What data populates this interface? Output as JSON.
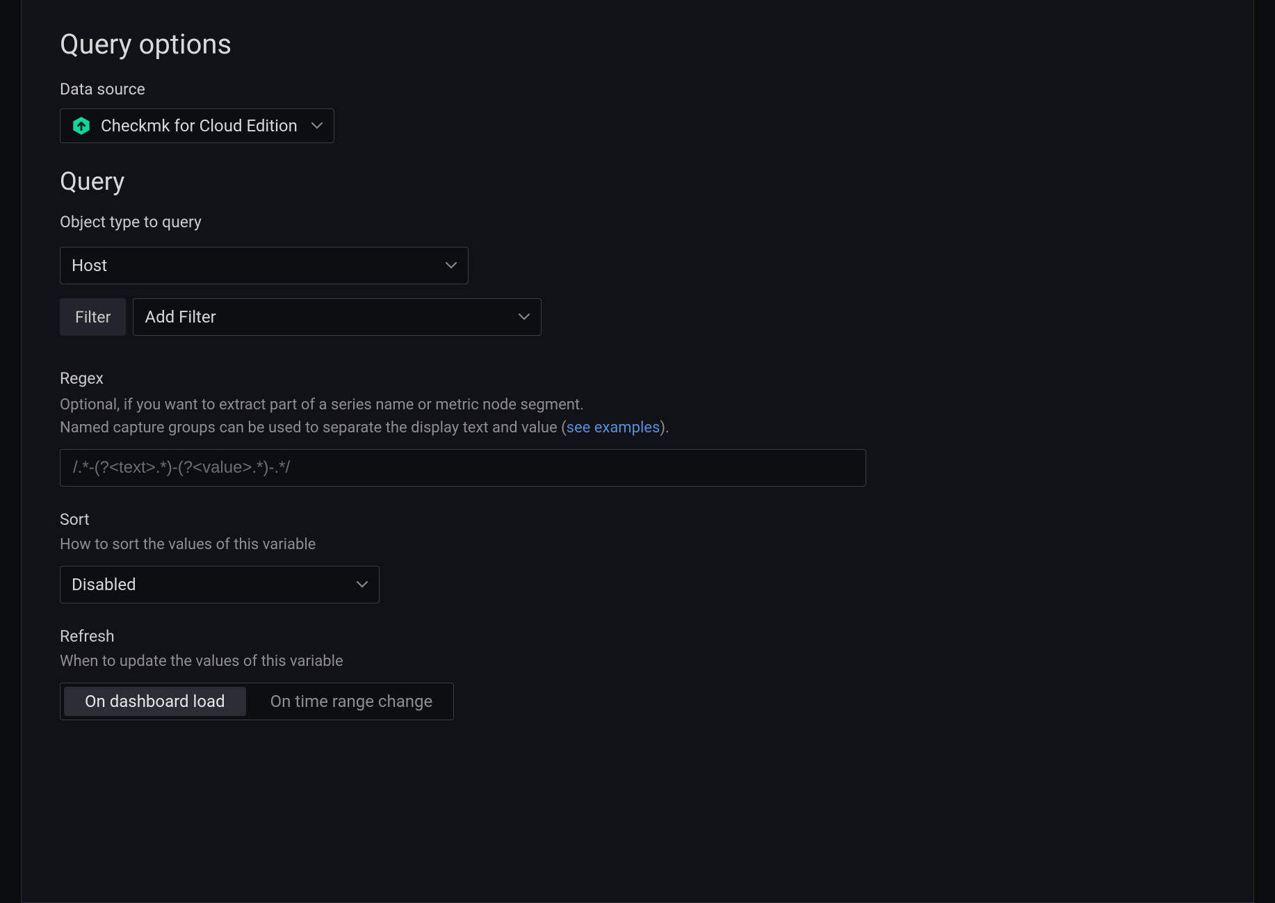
{
  "section": {
    "title": "Query options"
  },
  "dataSource": {
    "label": "Data source",
    "iconColor": "#15d696",
    "value": "Checkmk for Cloud Edition"
  },
  "query": {
    "heading": "Query",
    "objectType": {
      "label": "Object type to query",
      "value": "Host"
    },
    "filter": {
      "label": "Filter",
      "addLabel": "Add Filter"
    }
  },
  "regex": {
    "label": "Regex",
    "description1": "Optional, if you want to extract part of a series name or metric node segment.",
    "description2_pre": "Named capture groups can be used to separate the display text and value (",
    "description2_link": "see examples",
    "description2_post": ").",
    "placeholder": "/.*-(?<text>.*)-(?<value>.*)-.*/",
    "value": ""
  },
  "sort": {
    "label": "Sort",
    "description": "How to sort the values of this variable",
    "value": "Disabled"
  },
  "refresh": {
    "label": "Refresh",
    "description": "When to update the values of this variable",
    "options": [
      "On dashboard load",
      "On time range change"
    ],
    "selected": "On dashboard load"
  }
}
